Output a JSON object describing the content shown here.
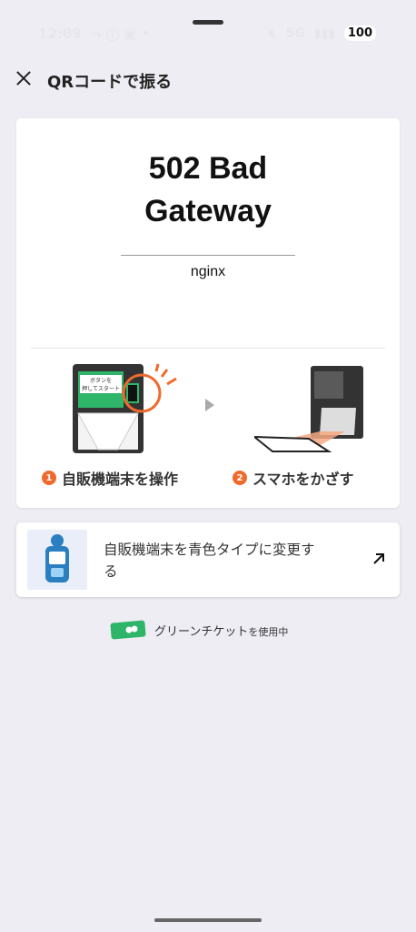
{
  "status_bar": {
    "time": "12:09",
    "network": "5G",
    "battery": "100"
  },
  "header": {
    "title": "QRコードで振る"
  },
  "error": {
    "title_line1": "502 Bad",
    "title_line2": "Gateway",
    "server": "nginx"
  },
  "steps": [
    {
      "number": "1",
      "label": "自販機端末を操作"
    },
    {
      "number": "2",
      "label": "スマホをかざす"
    }
  ],
  "machine_screen": {
    "line1": "ボタンを",
    "line2": "押してスタート"
  },
  "switch_card": {
    "text": "自販機端末を青色タイプに変更する",
    "icon": "arrow-up-right-icon"
  },
  "ticket": {
    "text": "グリーンチケット",
    "suffix": "を使用中"
  },
  "colors": {
    "background": "#eeedf4",
    "accent_orange": "#ef6a2c",
    "ticket_green": "#2fb56a",
    "machine_blue": "#2a7fc1"
  }
}
